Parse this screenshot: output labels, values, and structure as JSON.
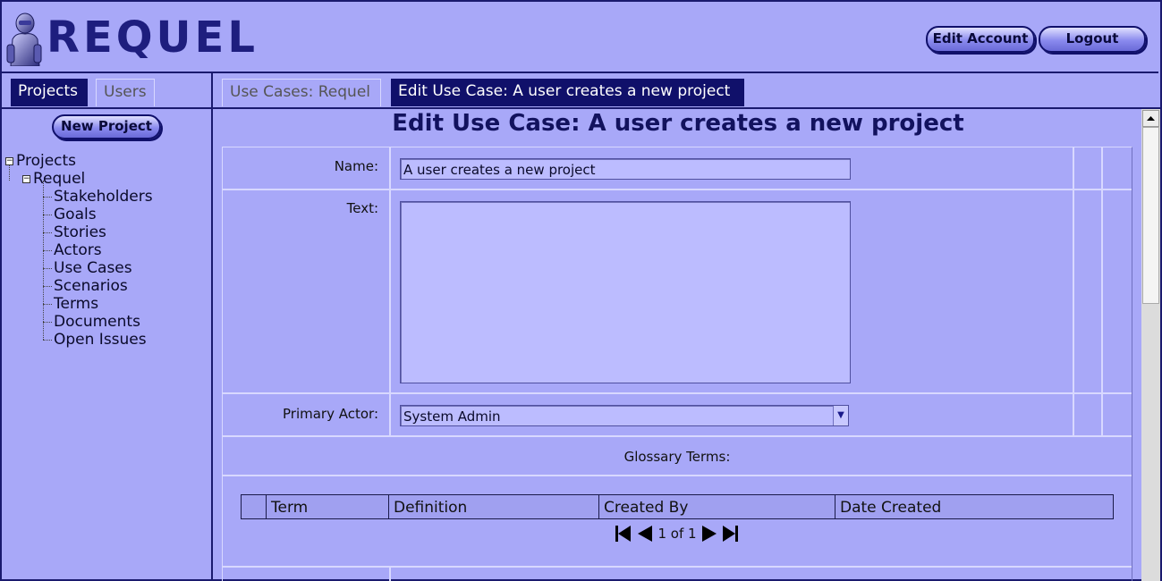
{
  "app": {
    "logo_text": "REQUEL",
    "edit_account_label": "Edit Account",
    "logout_label": "Logout"
  },
  "left_tabs": [
    {
      "label": "Projects",
      "active": true
    },
    {
      "label": "Users",
      "active": false
    }
  ],
  "right_tabs": [
    {
      "label": "Use Cases: Requel",
      "active": false
    },
    {
      "label": "Edit Use Case: A user creates a new project",
      "active": true
    }
  ],
  "sidebar": {
    "new_project_label": "New Project",
    "tree": {
      "root": "Projects",
      "project": "Requel",
      "items": [
        "Stakeholders",
        "Goals",
        "Stories",
        "Actors",
        "Use Cases",
        "Scenarios",
        "Terms",
        "Documents",
        "Open Issues"
      ]
    }
  },
  "main": {
    "title": "Edit Use Case: A user creates a new project",
    "form": {
      "name_label": "Name:",
      "name_value": "A user creates a new project",
      "text_label": "Text:",
      "text_value": "",
      "actor_label": "Primary Actor:",
      "actor_value": "System Admin",
      "glossary_label": "Glossary Terms:"
    },
    "glossary_table": {
      "columns": [
        "Term",
        "Definition",
        "Created By",
        "Date Created"
      ]
    },
    "pager": {
      "text": "1 of 1"
    }
  },
  "colors": {
    "background": "#a8a8f8",
    "dark_navy": "#10106a",
    "title": "#12125e",
    "input_bg": "#bcbcff"
  }
}
